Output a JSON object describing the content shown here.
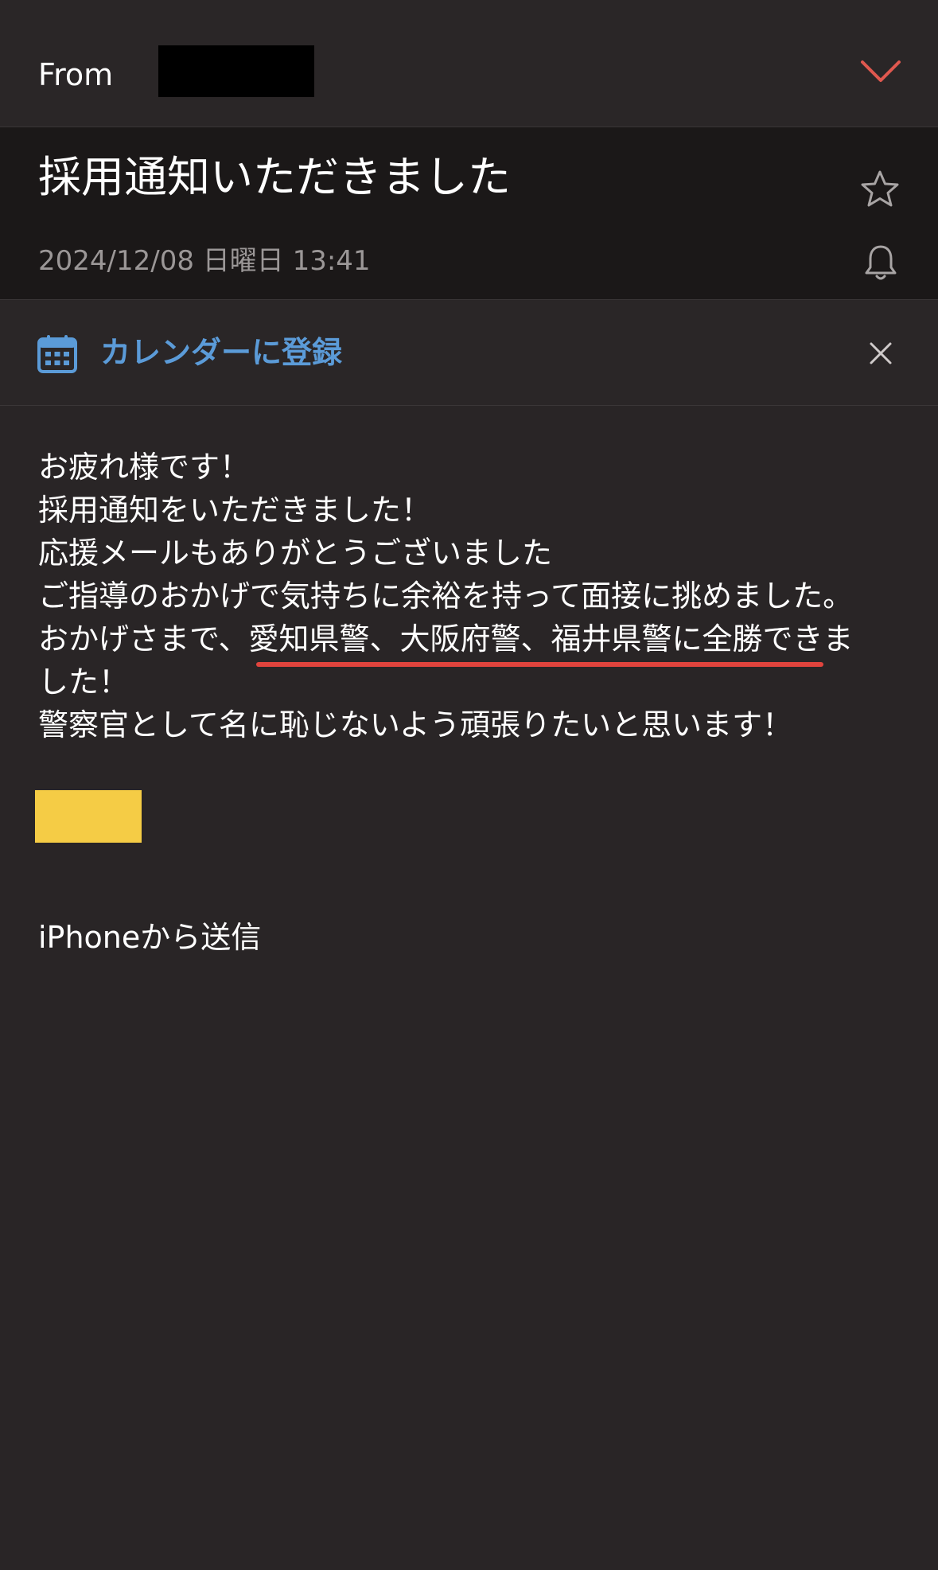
{
  "header": {
    "from_label": "From",
    "accent_color": "#e0584f"
  },
  "email": {
    "subject": "採用通知いただきました",
    "date": "2024/12/08 日曜日 13:41"
  },
  "calendar_banner": {
    "label": "カレンダーに登録",
    "accent_color": "#5b9bd8"
  },
  "body": {
    "lines": [
      "お疲れ様です！",
      "採用通知をいただきました！",
      "応援メールもありがとうございました",
      "ご指導のおかげで気持ちに余裕を持って面接に挑めました。",
      "おかげさまで、愛知県警、大阪府警、福井県警に全勝できま",
      "した！",
      "警察官として名に恥じないよう頑張りたいと思います！"
    ],
    "highlight_color": "#e0443d"
  },
  "signature": "iPhoneから送信",
  "icons": {
    "expand": "chevron-down-icon",
    "favorite": "star-icon",
    "notify": "bell-icon",
    "calendar": "calendar-icon",
    "close": "close-icon"
  }
}
